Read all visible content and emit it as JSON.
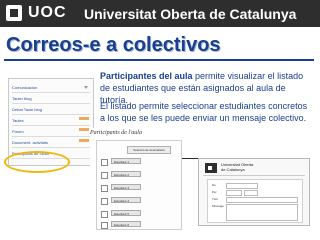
{
  "header": {
    "logo_text": "UOC",
    "university_name": "Universitat Oberta de Catalunya"
  },
  "slide_title": "Correos-e a colectivos",
  "description": {
    "p1_bold": "Participantes del aula",
    "p1_rest": " permite visualizar el listado de estudiantes que están asignados al aula de tutoría.",
    "p2": "El listado permite seleccionar estudiantes concretos a los que se les puede enviar un mensaje colectivo."
  },
  "sidebar": {
    "items": [
      {
        "label": "Comunicación"
      },
      {
        "label": "Tauler blog"
      },
      {
        "label": "Debat Taule blog"
      },
      {
        "label": "Taules"
      },
      {
        "label": "Fòrum"
      },
      {
        "label": "Document. activitats"
      },
      {
        "label": "Participants de l'aula"
      }
    ]
  },
  "participants": {
    "title": "Participants de l'aula",
    "select_button": "Selecció de destinataris",
    "students": [
      {
        "name": "Estudiant 1"
      },
      {
        "name": "Estudiant 2"
      },
      {
        "name": "Estudiant 3"
      },
      {
        "name": "Estudiant 4"
      },
      {
        "name": "Estudiant 5"
      },
      {
        "name": "Estudiant 6"
      }
    ]
  },
  "compose": {
    "uni_line1": "Universitat Oberta",
    "uni_line2": "de Catalunya",
    "labels": [
      "De",
      "Per",
      "Títol",
      "Missatge"
    ]
  },
  "colors": {
    "header_bg": "#2e2e2e",
    "title_blue": "#1a3f8f",
    "highlight_circle": "#f2b705",
    "sidebar_mark": "#f0a85c"
  }
}
